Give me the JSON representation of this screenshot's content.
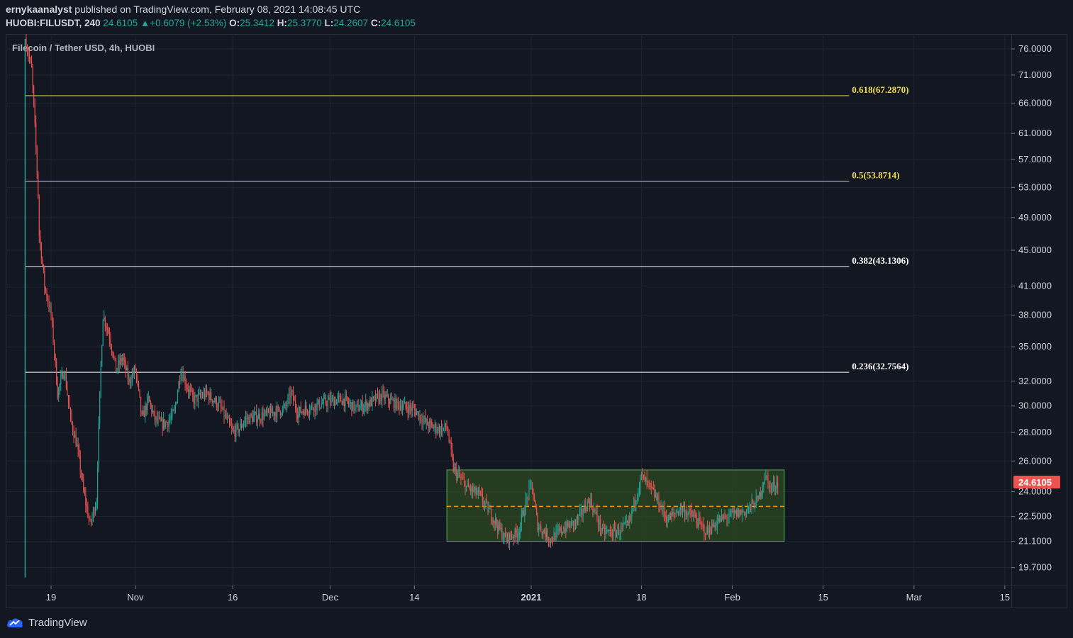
{
  "header": {
    "author": "ernykaanalyst",
    "published_text": "published on TradingView.com, February 08, 2021 14:08:45 UTC",
    "symbol": "HUOBI:FILUSDT, 240",
    "last": "24.6105",
    "change_arrow": "▲",
    "change": "+0.6079 (+2.53%)",
    "o_label": "O:",
    "o_value": "25.3412",
    "h_label": "H:",
    "h_value": "25.3770",
    "l_label": "L:",
    "l_value": "24.2607",
    "c_label": "C:",
    "c_value": "24.6105"
  },
  "branding": {
    "logo_icon": "tradingview-cloud-icon",
    "name": "TradingView"
  },
  "colors": {
    "background": "#131722",
    "grid": "#1f2433",
    "up": "#26a69a",
    "down": "#ef5350",
    "fib_gold": "#f0dc4e",
    "fib_white": "#ffffff",
    "range_fill": "#2e4a22",
    "range_border": "#4caf50",
    "mid_dash": "#ff9800",
    "price_tag": "#ef5350"
  },
  "chart_data": {
    "type": "candlestick",
    "title": "Filecoin / Tether USD, 4h, HUOBI",
    "y_scale": "log",
    "ylim": [
      18.8,
      79.0
    ],
    "y_ticks": [
      "76.0000",
      "71.0000",
      "66.0000",
      "61.0000",
      "57.0000",
      "53.0000",
      "49.0000",
      "45.0000",
      "41.0000",
      "38.0000",
      "35.0000",
      "32.0000",
      "30.0000",
      "28.0000",
      "26.0000",
      "24.0000",
      "22.5000",
      "21.1000",
      "19.7000"
    ],
    "x_range": [
      "2020-10-12",
      "2021-03-16"
    ],
    "x_ticks": [
      {
        "date": "2020-10-19",
        "label": "19",
        "bold": false
      },
      {
        "date": "2020-11-01",
        "label": "Nov",
        "bold": false
      },
      {
        "date": "2020-11-16",
        "label": "16",
        "bold": false
      },
      {
        "date": "2020-12-01",
        "label": "Dec",
        "bold": false
      },
      {
        "date": "2020-12-14",
        "label": "14",
        "bold": false
      },
      {
        "date": "2021-01-01",
        "label": "2021",
        "bold": true
      },
      {
        "date": "2021-01-18",
        "label": "18",
        "bold": false
      },
      {
        "date": "2021-02-01",
        "label": "Feb",
        "bold": false
      },
      {
        "date": "2021-02-15",
        "label": "15",
        "bold": false
      },
      {
        "date": "2021-03-01",
        "label": "Mar",
        "bold": false
      },
      {
        "date": "2021-03-15",
        "label": "15",
        "bold": false
      }
    ],
    "price_path": [
      [
        "2020-10-15",
        20.0
      ],
      [
        "2020-10-15",
        78.0
      ],
      [
        "2020-10-16",
        72.0
      ],
      [
        "2020-10-17",
        52.0
      ],
      [
        "2020-10-17",
        48.0
      ],
      [
        "2020-10-18",
        41.0
      ],
      [
        "2020-10-19",
        38.0
      ],
      [
        "2020-10-20",
        31.0
      ],
      [
        "2020-10-21",
        33.0
      ],
      [
        "2020-10-22",
        29.0
      ],
      [
        "2020-10-23",
        27.0
      ],
      [
        "2020-10-24",
        24.0
      ],
      [
        "2020-10-25",
        22.0
      ],
      [
        "2020-10-26",
        23.5
      ],
      [
        "2020-10-27",
        38.0
      ],
      [
        "2020-10-28",
        36.0
      ],
      [
        "2020-10-29",
        33.0
      ],
      [
        "2020-10-30",
        34.0
      ],
      [
        "2020-10-31",
        32.0
      ],
      [
        "2020-11-01",
        33.0
      ],
      [
        "2020-11-02",
        29.0
      ],
      [
        "2020-11-03",
        30.5
      ],
      [
        "2020-11-04",
        29.0
      ],
      [
        "2020-11-05",
        28.6
      ],
      [
        "2020-11-06",
        28.8
      ],
      [
        "2020-11-07",
        29.5
      ],
      [
        "2020-11-08",
        33.0
      ],
      [
        "2020-11-09",
        31.5
      ],
      [
        "2020-11-10",
        30.5
      ],
      [
        "2020-11-12",
        31.0
      ],
      [
        "2020-11-14",
        30.0
      ],
      [
        "2020-11-16",
        28.0
      ],
      [
        "2020-11-17",
        28.3
      ],
      [
        "2020-11-18",
        29.0
      ],
      [
        "2020-11-21",
        29.3
      ],
      [
        "2020-11-24",
        29.8
      ],
      [
        "2020-11-25",
        31.0
      ],
      [
        "2020-11-26",
        29.5
      ],
      [
        "2020-11-28",
        29.9
      ],
      [
        "2020-12-01",
        30.4
      ],
      [
        "2020-12-03",
        30.5
      ],
      [
        "2020-12-05",
        29.8
      ],
      [
        "2020-12-07",
        30.2
      ],
      [
        "2020-12-09",
        30.8
      ],
      [
        "2020-12-11",
        30.2
      ],
      [
        "2020-12-14",
        29.7
      ],
      [
        "2020-12-16",
        28.6
      ],
      [
        "2020-12-18",
        28.2
      ],
      [
        "2020-12-19",
        28.4
      ],
      [
        "2020-12-20",
        25.5
      ],
      [
        "2020-12-22",
        24.3
      ],
      [
        "2020-12-24",
        23.8
      ],
      [
        "2020-12-26",
        22.5
      ],
      [
        "2020-12-28",
        21.2
      ],
      [
        "2020-12-30",
        21.6
      ],
      [
        "2021-01-01",
        24.5
      ],
      [
        "2021-01-02",
        22.0
      ],
      [
        "2021-01-04",
        21.2
      ],
      [
        "2021-01-06",
        21.8
      ],
      [
        "2021-01-08",
        22.2
      ],
      [
        "2021-01-10",
        23.5
      ],
      [
        "2021-01-12",
        21.6
      ],
      [
        "2021-01-14",
        21.6
      ],
      [
        "2021-01-16",
        22.0
      ],
      [
        "2021-01-18",
        25.0
      ],
      [
        "2021-01-20",
        23.8
      ],
      [
        "2021-01-22",
        22.3
      ],
      [
        "2021-01-24",
        23.0
      ],
      [
        "2021-01-26",
        22.5
      ],
      [
        "2021-01-28",
        21.6
      ],
      [
        "2021-01-30",
        22.3
      ],
      [
        "2021-02-01",
        22.6
      ],
      [
        "2021-02-03",
        22.8
      ],
      [
        "2021-02-05",
        23.5
      ],
      [
        "2021-02-06",
        25.0
      ],
      [
        "2021-02-07",
        24.2
      ],
      [
        "2021-02-08",
        24.6105
      ]
    ],
    "fib_levels": [
      {
        "ratio": "0.618",
        "price": 67.287,
        "label": "0.618(67.2870)",
        "color": "#f0dc4e"
      },
      {
        "ratio": "0.5",
        "price": 53.8714,
        "label": "0.5(53.8714)",
        "color": "#f0dc4e"
      },
      {
        "ratio": "0.382",
        "price": 43.1306,
        "label": "0.382(43.1306)",
        "color": "#ffffff"
      },
      {
        "ratio": "0.236",
        "price": 32.7564,
        "label": "0.236(32.7564)",
        "color": "#ffffff"
      }
    ],
    "fib_start": "2020-10-15",
    "fib_end": "2021-02-19",
    "range_box": {
      "start": "2020-12-19",
      "end": "2021-02-09",
      "top": 25.4,
      "bottom": 21.1,
      "mid": 23.1
    },
    "last_price_label": "24.6105",
    "last_price": 24.6105
  }
}
